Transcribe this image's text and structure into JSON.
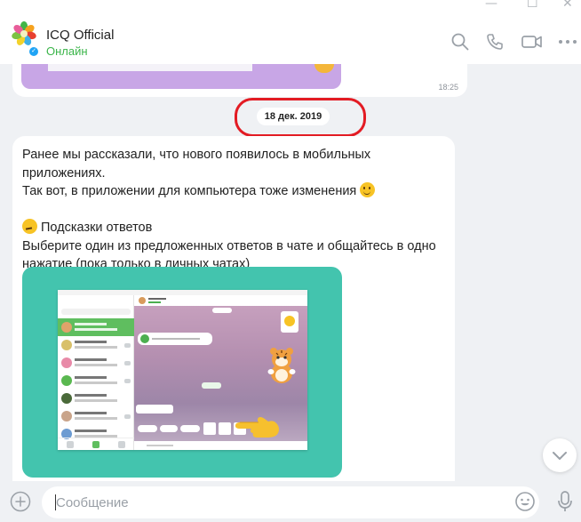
{
  "window": {
    "minimize_glyph": "—",
    "maximize_glyph": "☐",
    "close_glyph": "✕"
  },
  "header": {
    "chat_name": "ICQ Official",
    "status": "Онлайн",
    "icons": [
      "search-icon",
      "phone-icon",
      "video-icon",
      "more-icon"
    ]
  },
  "messages": {
    "previous": {
      "time": "18:25"
    },
    "date_separator": "18 дек. 2019",
    "current": {
      "paragraph1_line1": "Ранее мы рассказали, что нового появилось в мобильных приложениях.",
      "paragraph1_line2": "Так вот, в приложении для компьютера тоже изменения",
      "feature_title": "Подсказки ответов",
      "feature_line1": "Выберите один из предложенных ответов в чате и общайтесь в одно",
      "feature_line2": "нажатие (пока только в личных чатах)"
    }
  },
  "composer": {
    "placeholder": "Сообщение"
  },
  "colors": {
    "online": "#3bb54a",
    "accent_teal": "#43c4ae",
    "highlight_ring": "#e31b23",
    "background": "#eff1f4"
  }
}
